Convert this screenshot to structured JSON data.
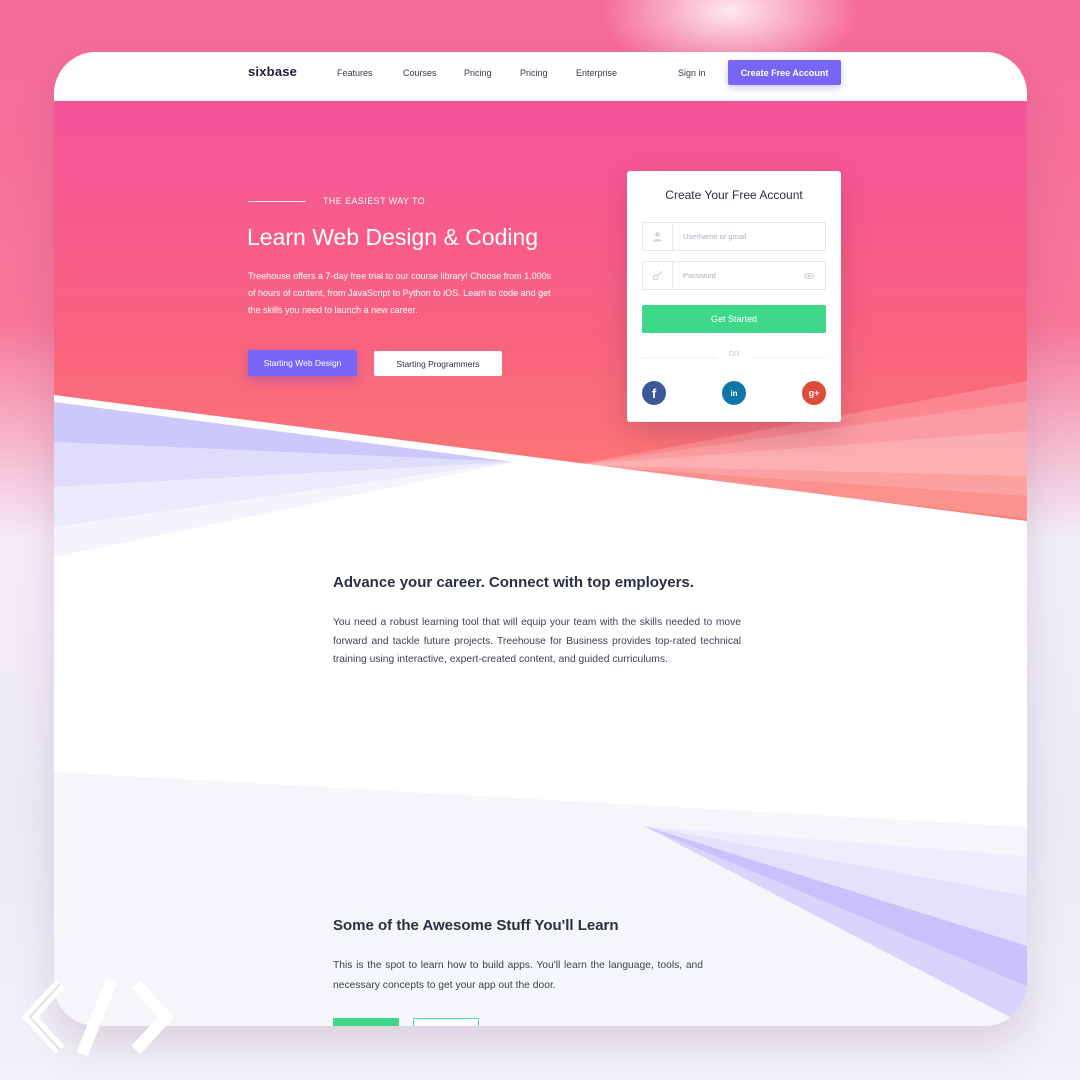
{
  "colors": {
    "hero_top": "#f5549c",
    "hero_bottom": "#fd7d74",
    "accent_purple": "#7766f5",
    "accent_green": "#3fd88a",
    "text_dark": "#2b2f44",
    "facebook": "#3b5998",
    "linkedin": "#0e76a8",
    "google_plus": "#dd4b39"
  },
  "nav": {
    "logo": "sixbase",
    "links": [
      "Features",
      "Courses",
      "Pricing",
      "Pricing",
      "Enterprise"
    ],
    "sign_in": "Sign in",
    "cta": "Create Free Account"
  },
  "hero": {
    "eyebrow": "THE EASIEST WAY TO",
    "title": "Learn Web Design & Coding",
    "description": "Treehouse offers a 7-day free trial to our course library! Choose from 1,000s of hours of content, from JavaScript to Python to iOS. Learn to code and get the skills you need to launch a new career.",
    "btn_primary": "Starting Web Design",
    "btn_secondary": "Starting  Programmers"
  },
  "signup": {
    "title": "Create Your Free Account",
    "username_placeholder": "Username or gmail",
    "password_placeholder": "Password",
    "submit": "Get Started",
    "or": "OR",
    "social": [
      {
        "name": "facebook",
        "glyph": "f",
        "icon": "facebook-icon"
      },
      {
        "name": "linkedin",
        "glyph": "in",
        "icon": "linkedin-icon"
      },
      {
        "name": "google-plus",
        "glyph": "g+",
        "icon": "google-plus-icon"
      }
    ]
  },
  "section_career": {
    "title": "Advance your career. Connect with top employers.",
    "body": "You need a robust learning tool that will equip your team with the skills needed to move forward and tackle future projects. Treehouse for Business provides top-rated technical training using interactive, expert-created content, and guided curriculums."
  },
  "section_learn": {
    "title": "Some of the Awesome Stuff You'll Learn",
    "body": "This is the spot to learn how to build apps. You'll learn the language, tools, and necessary concepts to get your app out the door."
  },
  "watermark": {
    "icon": "code-brackets-icon"
  }
}
